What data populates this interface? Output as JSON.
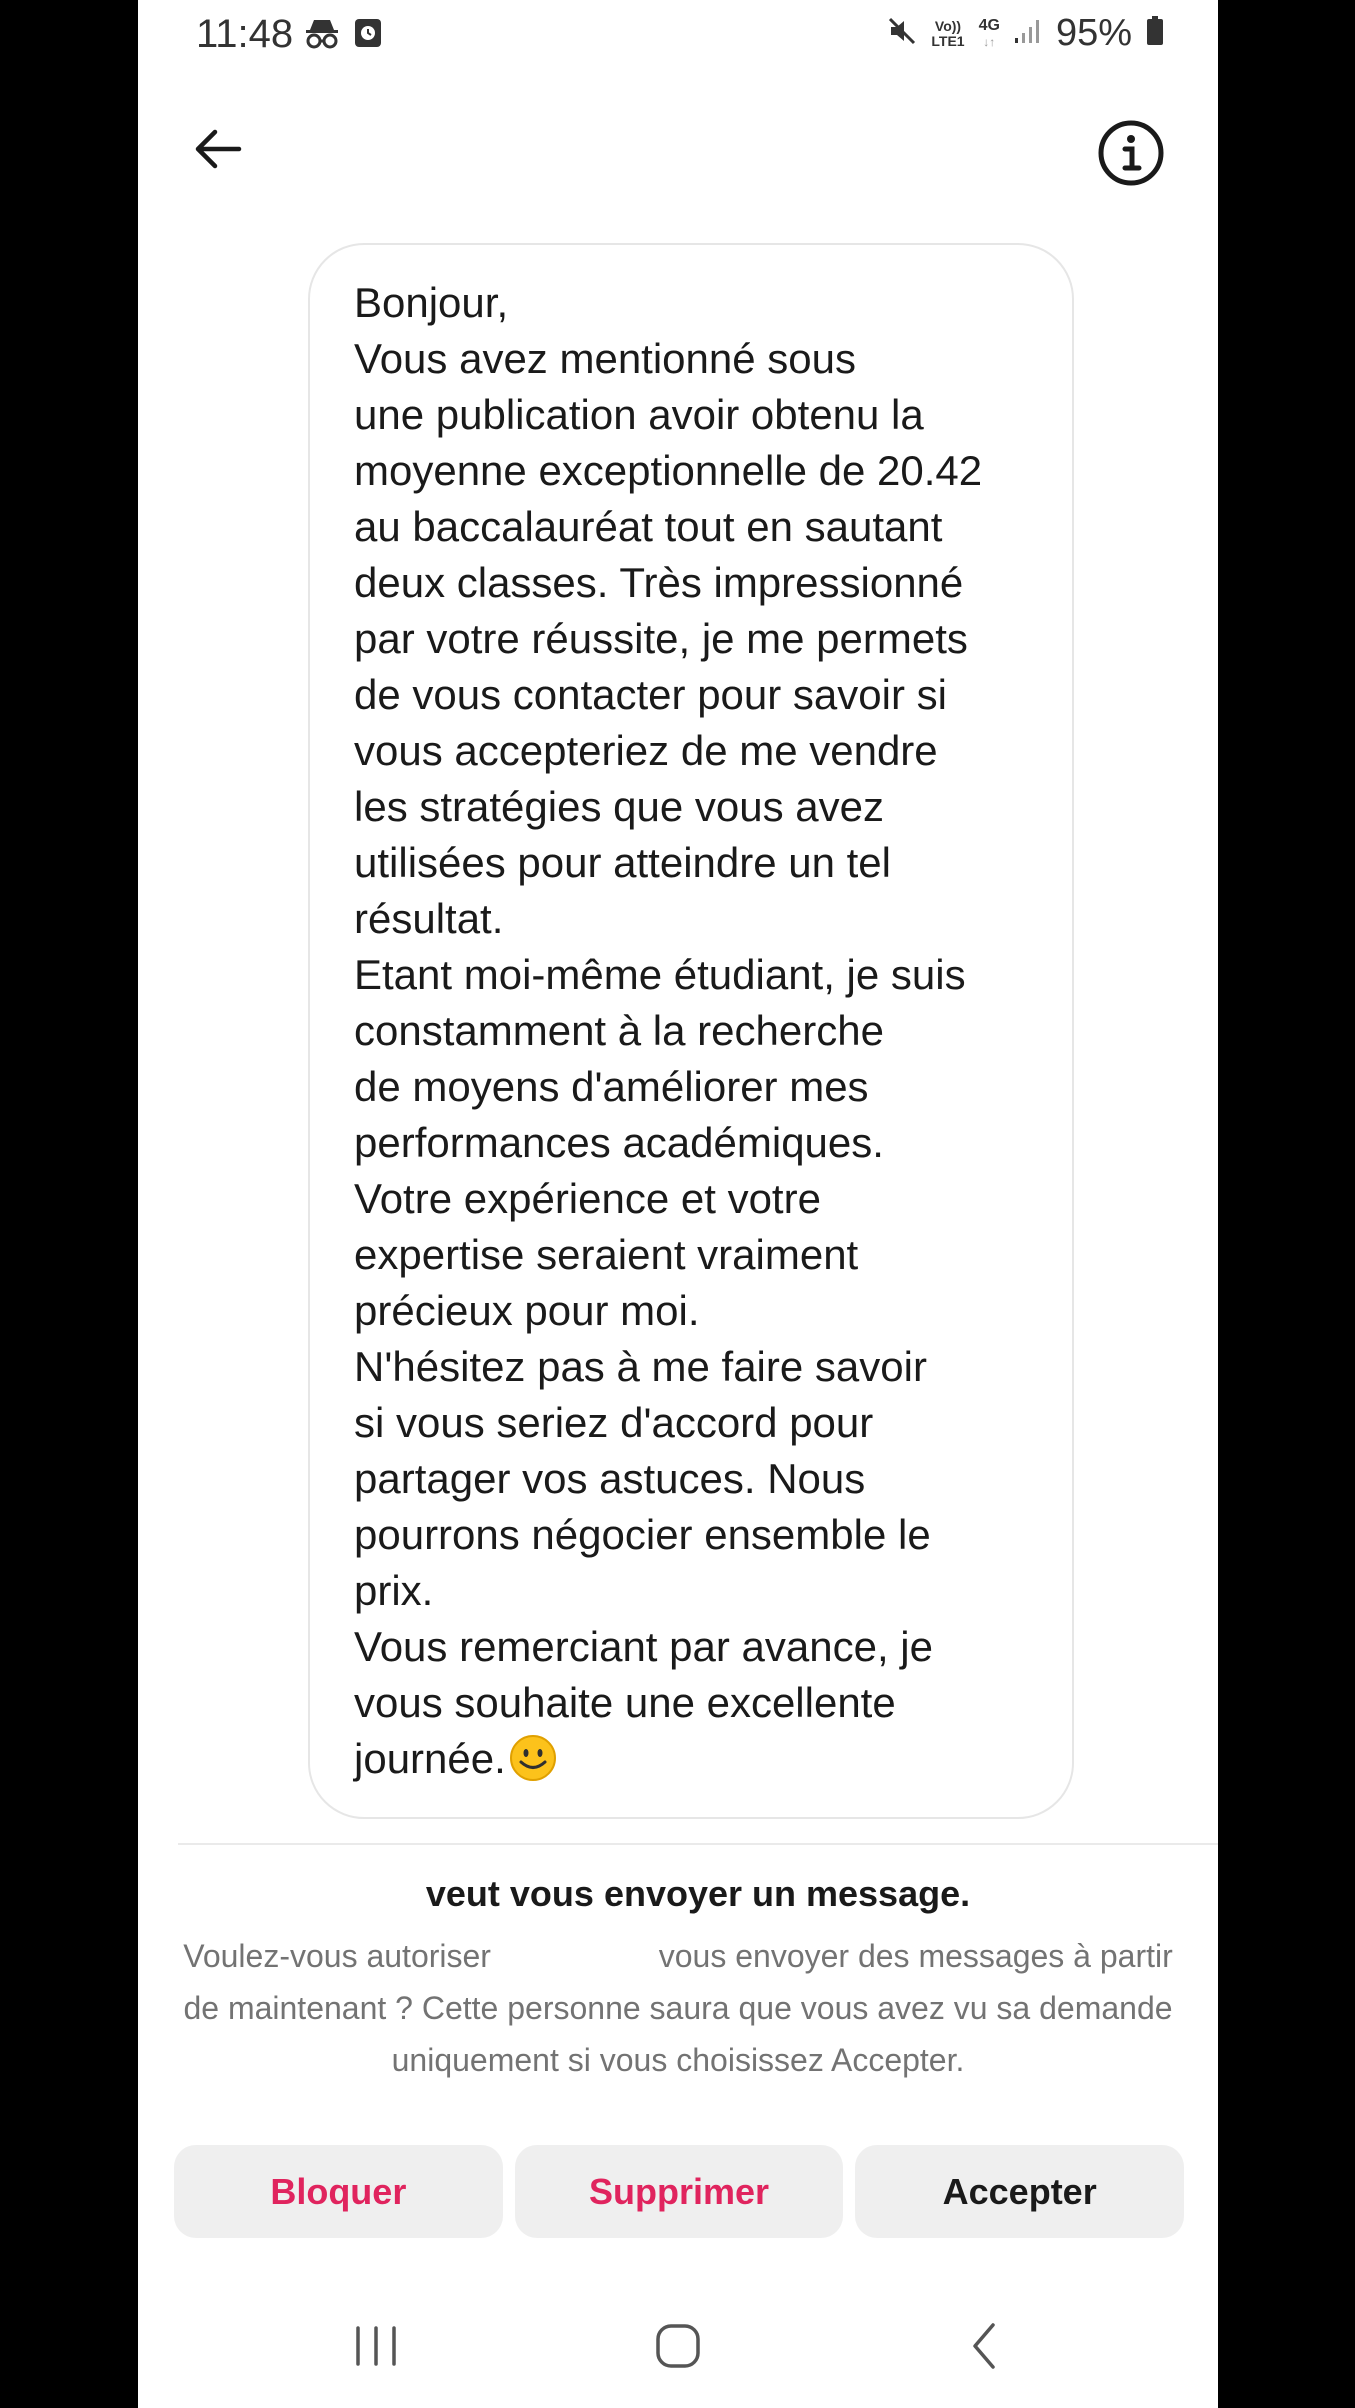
{
  "status_bar": {
    "time": "11:48",
    "battery": "95%",
    "network": "4G",
    "volte": "Vo))",
    "lte": "LTE1"
  },
  "app_bar": {
    "back_icon": "arrow-left-icon",
    "info_icon": "info-icon"
  },
  "message": {
    "text": "Bonjour,\nVous avez mentionné sous\nune publication avoir obtenu la\nmoyenne exceptionnelle de 20.42\nau baccalauréat tout en sautant\ndeux classes. Très impressionné\npar votre réussite, je me permets\nde vous contacter pour savoir si\nvous accepteriez de me vendre\nles stratégies que vous avez\nutilisées pour atteindre un tel\nrésultat.\nEtant moi-même étudiant, je suis\nconstamment à la recherche\nde moyens d'améliorer mes\nperformances académiques.\nVotre expérience et votre\nexpertise seraient vraiment\nprécieux pour moi.\nN'hésitez pas à me faire savoir\nsi vous seriez d'accord pour\npartager vos astuces. Nous\npourrons négocier ensemble le\nprix.\nVous remerciant par avance, je\nvous souhaite une excellente\njournée.",
    "emoji": "smiling-face-emoji"
  },
  "request": {
    "title": "veut vous envoyer un message.",
    "desc_part1": "Voulez-vous autoriser",
    "desc_part2": "vous envoyer des messages à partir de maintenant ? Cette personne saura que vous avez vu sa demande uniquement si vous choisissez Accepter."
  },
  "actions": {
    "block": "Bloquer",
    "delete": "Supprimer",
    "accept": "Accepter"
  },
  "colors": {
    "danger": "#e0245e",
    "primary_text": "#1a1a1a",
    "secondary_text": "#737373",
    "button_bg": "#efefef"
  }
}
